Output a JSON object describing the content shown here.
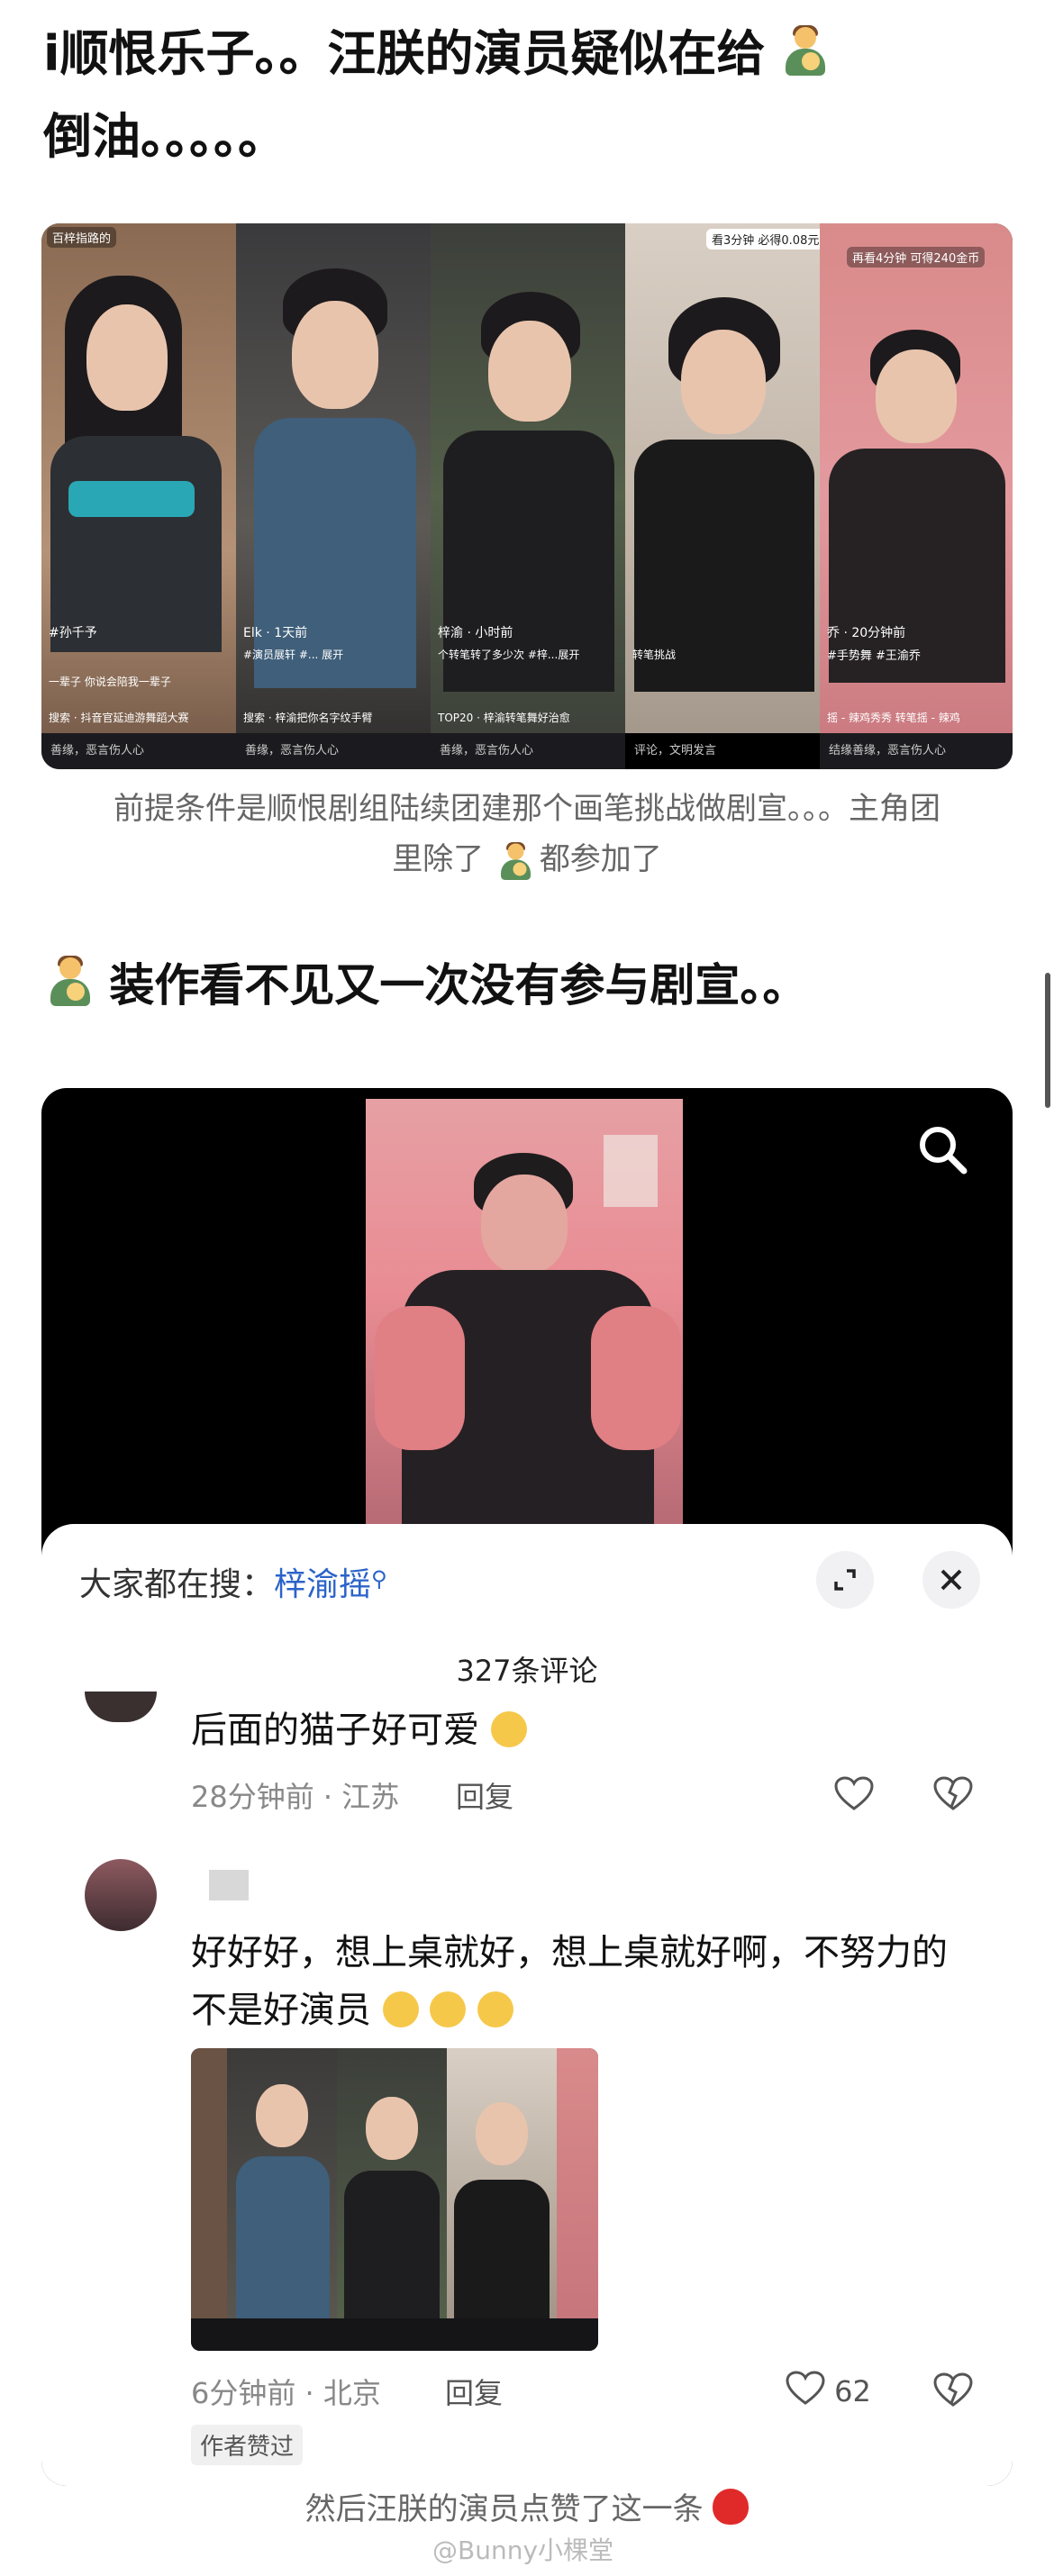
{
  "post": {
    "line1": "i顺恨乐子。。汪朕的演员疑似在给",
    "line2": "倒油。。。。。",
    "caption_line1": "前提条件是顺恨剧组陆续团建那个画笔挑战做剧宣。。。主角团",
    "caption_line2_a": "里除了",
    "caption_line2_b": "都参加了",
    "statement": "装作看不见又一次没有参与剧宣。。"
  },
  "collage": {
    "thumbs": [
      {
        "top_label": "百梓指路的",
        "caption": "#孙千予",
        "caption2": "一辈子  你说会陪我一辈子",
        "bottom": "搜索 · 抖音官延迪游舞蹈大赛",
        "bar": "善缘，恶言伤人心"
      },
      {
        "top_label": "",
        "caption": "Elk · 1天前",
        "caption2": "#演员展轩 #... 展开",
        "bottom": "搜索 · 梓渝把你名字纹手臂",
        "bar": "善缘，恶言伤人心"
      },
      {
        "top_label": "",
        "caption": "梓渝 · 小时前",
        "caption2": "个转笔转了多少次 #梓...展开",
        "bottom": "TOP20 · 梓渝转笔舞好治愈",
        "bar": "善缘，恶言伤人心"
      },
      {
        "top_label": "看3分钟 必得0.08元",
        "caption": "转笔挑战",
        "caption2": "",
        "bottom": "评论，文明发言",
        "bar": ""
      },
      {
        "top_label": "再看4分钟 可得240金币",
        "caption": "乔 · 20分钟前",
        "caption2": "#手势舞 #王渝乔",
        "bottom": "摇 - 辣鸡秀秀  转笔摇 - 辣鸡",
        "bar": "结缘善缘，恶言伤人心"
      }
    ]
  },
  "video": {
    "search_icon": "search-icon"
  },
  "comments_panel": {
    "trending_label": "大家都在搜：",
    "trending_term": "梓渝摇",
    "count_label": "327条评论",
    "expand_icon": "expand-icon",
    "close_icon": "close-icon"
  },
  "comment1": {
    "text": "后面的猫子好可爱",
    "time_loc": "28分钟前 · 江苏",
    "reply": "回复"
  },
  "comment2": {
    "text_line1": "好好好，想上桌就好，想上桌就好啊，不努力的",
    "text_line2": "不是好演员",
    "time_loc": "6分钟前 · 北京",
    "reply": "回复",
    "likes": "62",
    "author_liked": "作者赞过"
  },
  "footer": {
    "caption": "然后汪朕的演员点赞了这一条",
    "watermark": "@Bunny小棵堂"
  },
  "colors": {
    "accent_blue": "#2b63c9",
    "video_bg": "#000000",
    "muted": "#888888"
  }
}
